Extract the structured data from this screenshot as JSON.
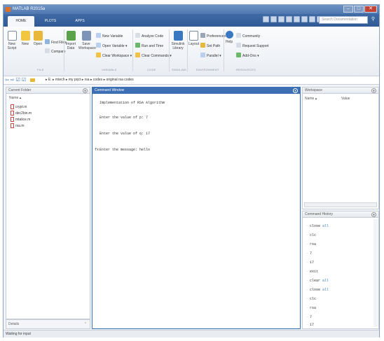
{
  "window": {
    "title": "MATLAB R2015a"
  },
  "tabs": [
    {
      "label": "HOME"
    },
    {
      "label": "PLOTS"
    },
    {
      "label": "APPS"
    }
  ],
  "search": {
    "placeholder": "Search Documentation"
  },
  "ribbon": {
    "file": {
      "new_script": "New Script",
      "new": "New",
      "open": "Open",
      "find_files": "Find Files",
      "compare": "Compare",
      "group": "FILE"
    },
    "variable": {
      "import_data": "Import Data",
      "save_workspace": "Save Workspace",
      "new_variable": "New Variable",
      "open_variable": "Open Variable ▾",
      "clear_workspace": "Clear Workspace ▾",
      "group": "VARIABLE"
    },
    "code": {
      "analyze_code": "Analyze Code",
      "run_and_time": "Run and Time",
      "clear_commands": "Clear Commands ▾",
      "group": "CODE"
    },
    "simulink": {
      "library": "Simulink Library",
      "group": "SIMULINK"
    },
    "environment": {
      "layout": "Layout",
      "preferences": "Preferences",
      "set_path": "Set Path",
      "parallel": "Parallel ▾",
      "group": "ENVIRONMENT"
    },
    "resources": {
      "help": "Help",
      "community": "Community",
      "request_support": "Request Support",
      "addons": "Add-Ons ▾",
      "group": "RESOURCES"
    }
  },
  "address": {
    "path": "▸ E: ▸ mtech ▸ my prjct ▸ rsa ▸ codes ▸ original rsa codes"
  },
  "current_folder": {
    "title": "Current Folder",
    "column": "Name ▴",
    "files": [
      "crypt.m",
      "dec2bin.m",
      "mtalice.m",
      "rsa.m"
    ],
    "details": "Details"
  },
  "command_window": {
    "title": "Command Window",
    "lines": [
      "Implementation of RSA Algorithm",
      "Enter the value of p: 7",
      "Enter the value of q: 17",
      "Enter the message: hello"
    ],
    "prompt_symbol": "fx"
  },
  "workspace": {
    "title": "Workspace",
    "col_name": "Name ▴",
    "col_value": "Value"
  },
  "history": {
    "title": "Command History",
    "items": [
      {
        "cmd": "close",
        "arg": "all"
      },
      {
        "cmd": "clc",
        "arg": ""
      },
      {
        "cmd": "rsa",
        "arg": ""
      },
      {
        "cmd": "7",
        "arg": ""
      },
      {
        "cmd": "17",
        "arg": ""
      },
      {
        "cmd": "exit",
        "arg": ""
      },
      {
        "cmd": "clear",
        "arg": "all"
      },
      {
        "cmd": "close",
        "arg": "all"
      },
      {
        "cmd": "clc",
        "arg": ""
      },
      {
        "cmd": "rsa",
        "arg": ""
      },
      {
        "cmd": "7",
        "arg": ""
      },
      {
        "cmd": "17",
        "arg": ""
      }
    ]
  },
  "status": {
    "text": "Waiting for input"
  },
  "colors": {
    "titlebar": "#4f78b0",
    "command_border": "#3c6fb4",
    "keyword": "#a020f0"
  }
}
